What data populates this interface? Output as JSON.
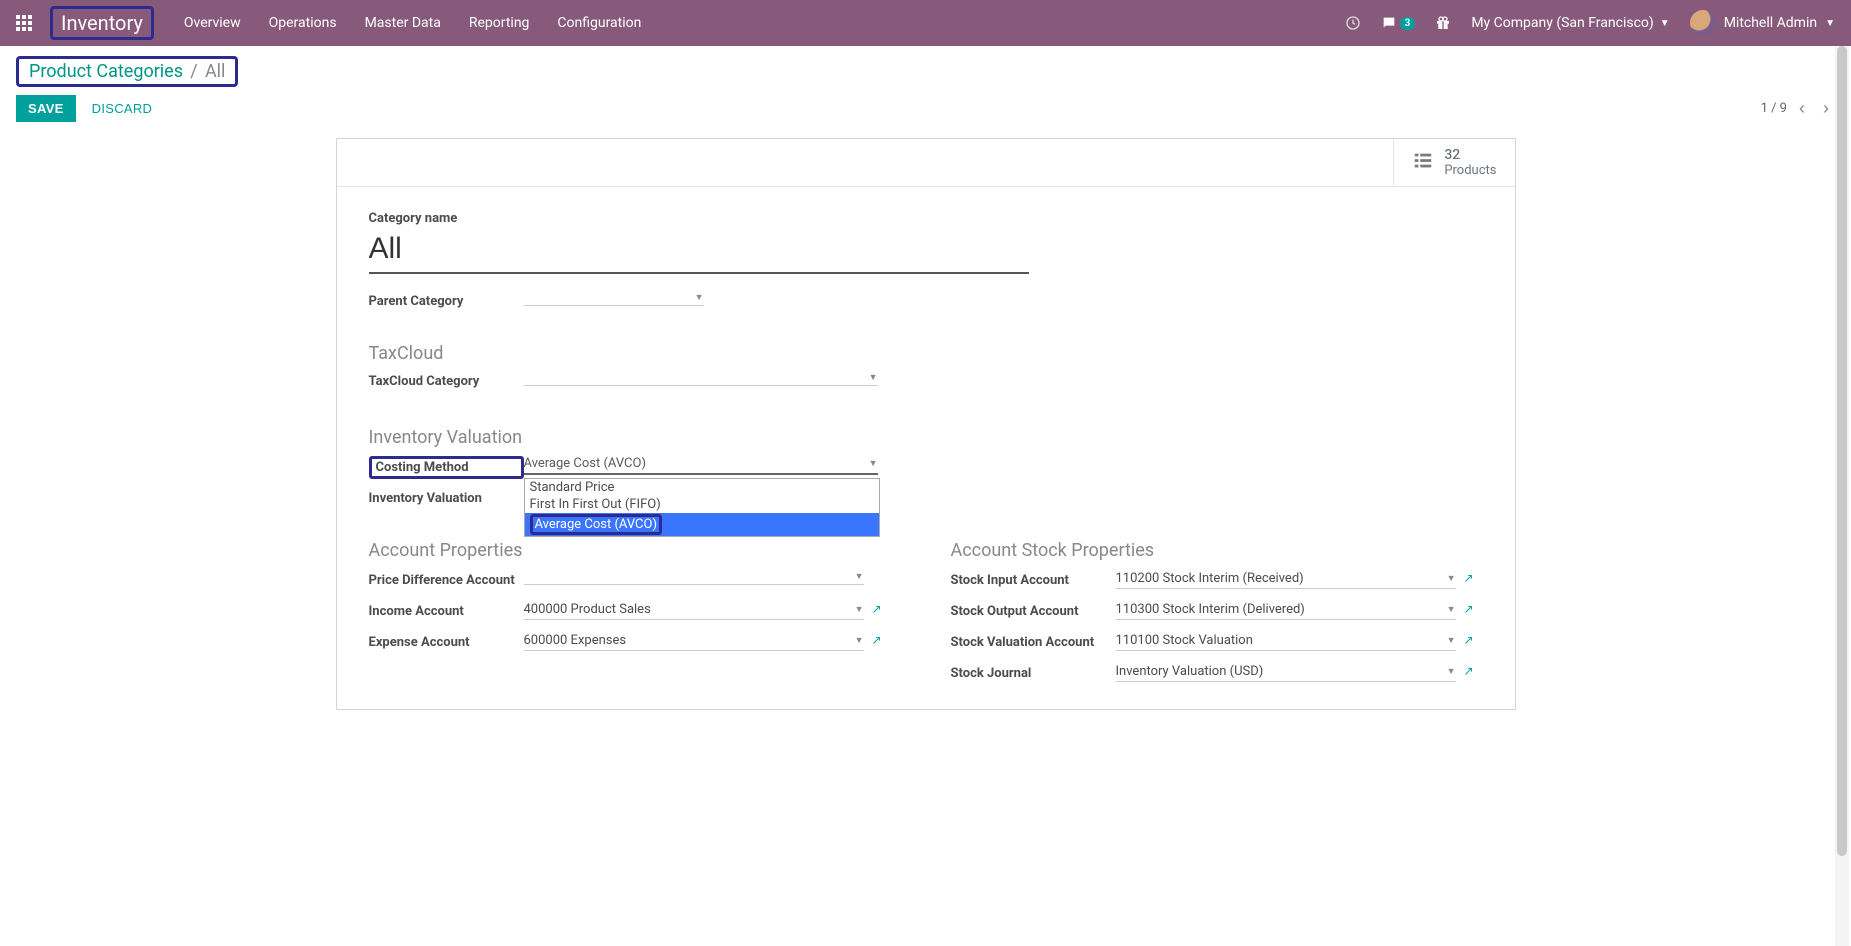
{
  "nav": {
    "brand": "Inventory",
    "items": [
      "Overview",
      "Operations",
      "Master Data",
      "Reporting",
      "Configuration"
    ],
    "msg_count": "3",
    "company": "My Company (San Francisco)",
    "user": "Mitchell Admin"
  },
  "breadcrumb": {
    "parent": "Product Categories",
    "current": "All"
  },
  "buttons": {
    "save": "Save",
    "discard": "Discard"
  },
  "pager": {
    "pos": "1 / 9"
  },
  "stat": {
    "count": "32",
    "label": "Products"
  },
  "form": {
    "name_label": "Category name",
    "name_value": "All",
    "parent_label": "Parent Category",
    "parent_value": ""
  },
  "taxcloud": {
    "heading": "TaxCloud",
    "cat_label": "TaxCloud Category",
    "cat_value": ""
  },
  "inventory": {
    "heading": "Inventory Valuation",
    "costing_label": "Costing Method",
    "costing_value": "Average Cost (AVCO)",
    "costing_options": [
      "Standard Price",
      "First In First Out (FIFO)",
      "Average Cost (AVCO)"
    ],
    "valuation_label": "Inventory Valuation"
  },
  "accprops": {
    "heading": "Account Properties",
    "price_diff_label": "Price Difference Account",
    "price_diff_value": "",
    "income_label": "Income Account",
    "income_value": "400000 Product Sales",
    "expense_label": "Expense Account",
    "expense_value": "600000 Expenses"
  },
  "stockprops": {
    "heading": "Account Stock Properties",
    "input_label": "Stock Input Account",
    "input_value": "110200 Stock Interim (Received)",
    "output_label": "Stock Output Account",
    "output_value": "110300 Stock Interim (Delivered)",
    "valuation_label": "Stock Valuation Account",
    "valuation_value": "110100 Stock Valuation",
    "journal_label": "Stock Journal",
    "journal_value": "Inventory Valuation (USD)"
  }
}
